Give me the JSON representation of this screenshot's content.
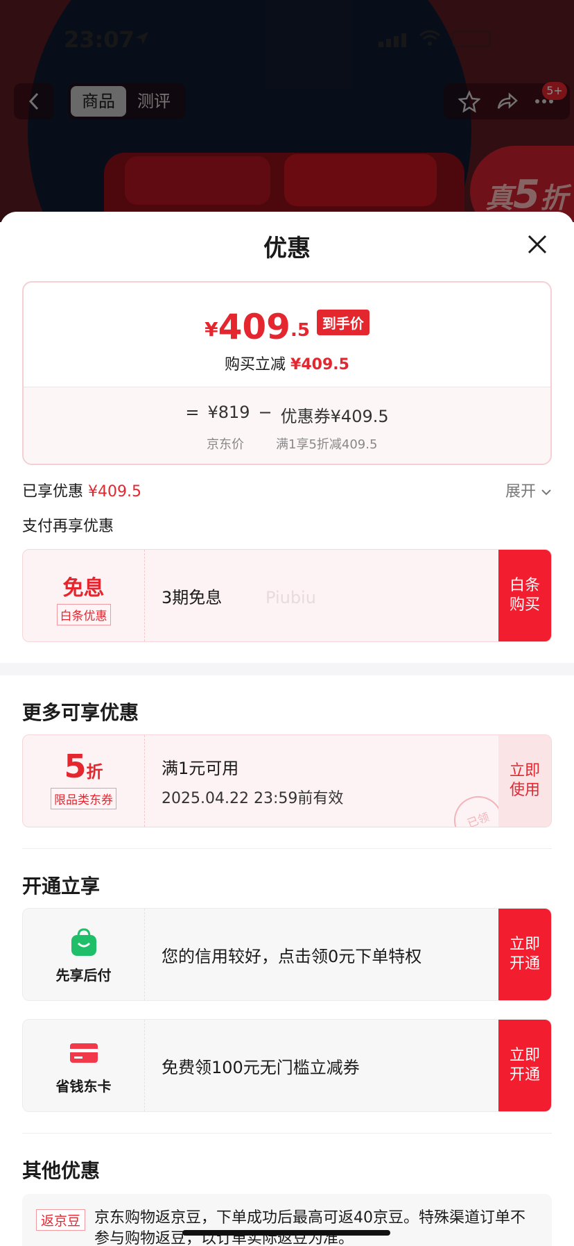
{
  "status_bar": {
    "time": "23:07"
  },
  "nav": {
    "tabs": [
      "商品",
      "测评"
    ],
    "badge": "5+"
  },
  "bg": {
    "promo_prefix": "真",
    "promo_number": "5",
    "promo_suffix": "折"
  },
  "sheet": {
    "title": "优惠",
    "price_card": {
      "symbol": "¥",
      "integer": "409",
      "decimal": ".5",
      "tag": "到手价",
      "sub_label": "购买立减",
      "sub_value": "¥409.5",
      "calc": {
        "equals": "=",
        "jd_price": "¥819",
        "minus": "−",
        "coupon": "优惠券¥409.5",
        "jd_price_label": "京东价",
        "coupon_label": "满1享5折减409.5"
      }
    },
    "enjoyed_label": "已享优惠",
    "enjoyed_value": "¥409.5",
    "expand": "展开",
    "pay_more": "支付再享优惠",
    "baitiao": {
      "big": "免息",
      "tag": "白条优惠",
      "text": "3期免息",
      "watermark": "Piubiu",
      "action": "白条\n购买"
    },
    "more": {
      "title": "更多可享优惠",
      "coupon": {
        "big": "5",
        "big_unit": "折",
        "tag": "限品类东券",
        "line1": "满1元可用",
        "line2": "2025.04.22 23:59前有效",
        "action": "立即\n使用",
        "stamp": "已领"
      }
    },
    "open": {
      "title": "开通立享",
      "items": [
        {
          "name": "先享后付",
          "text": "您的信用较好，点击领0元下单特权",
          "action": "立即\n开通"
        },
        {
          "name": "省钱东卡",
          "text": "免费领100元无门槛立减券",
          "action": "立即\n开通"
        }
      ]
    },
    "other": {
      "title": "其他优惠",
      "tag": "返京豆",
      "text": "京东购物返京豆，下单成功后最高可返40京豆。特殊渠道订单不参与购物返豆，以订单实际返豆为准。"
    }
  }
}
